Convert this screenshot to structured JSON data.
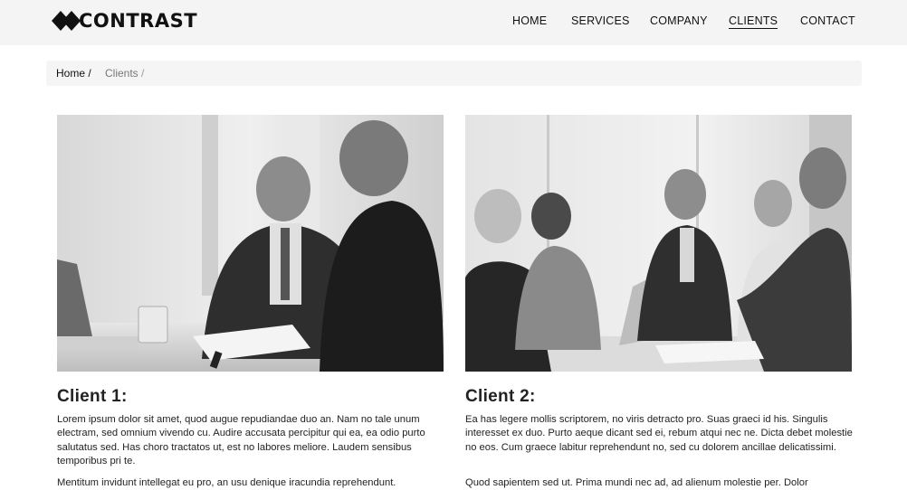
{
  "brand": {
    "name": "CONTRAST"
  },
  "nav": {
    "items": [
      {
        "label": "HOME"
      },
      {
        "label": "SERVICES"
      },
      {
        "label": "COMPANY"
      },
      {
        "label": "CLIENTS"
      },
      {
        "label": "CONTACT"
      }
    ],
    "active": "CLIENTS"
  },
  "breadcrumb": {
    "home": "Home /",
    "separator": "/",
    "current": "Clients"
  },
  "clients": [
    {
      "title": "Client 1:",
      "paragraph1": "Lorem ipsum dolor sit amet, quod augue repudiandae duo an. Nam no tale unum electram, sed omnium vivendo cu. Audire accusata percipitur qui ea, ea odio purto salutatus sed. Has choro tractatos ut, est no labores meliore. Laudem sensibus temporibus pri te.",
      "paragraph2": "Mentitum invidunt intellegat eu pro, an usu denique iracundia reprehendunt."
    },
    {
      "title": "Client 2:",
      "paragraph1": "Ea has legere mollis scriptorem, no viris detracto pro. Suas graeci id his. Singulis interesset ex duo. Purto aeque dicant sed ei, rebum atqui nec ne. Dicta debet molestie no eos. Cum graece labitur reprehendunt no, sed cu dolorem ancillae delicatissimi.",
      "paragraph2": "Quod sapientem sed ut. Prima mundi nec ad, ad alienum molestie per. Dolor"
    }
  ],
  "icons": {
    "logo": "diamond-logo-icon"
  },
  "colors": {
    "header_bg": "#f4f4f4",
    "breadcrumb_bg": "#f5f5f5",
    "text": "#111111"
  }
}
